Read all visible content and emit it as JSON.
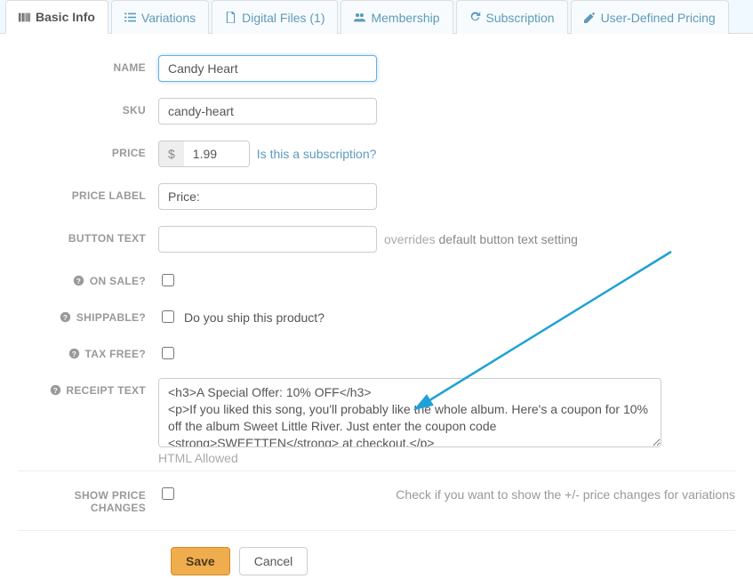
{
  "tabs": {
    "basic_info": "Basic Info",
    "variations": "Variations",
    "digital_files": "Digital Files (1)",
    "membership": "Membership",
    "subscription": "Subscription",
    "user_defined_pricing": "User-Defined Pricing"
  },
  "labels": {
    "name": "NAME",
    "sku": "SKU",
    "price": "PRICE",
    "price_label": "PRICE LABEL",
    "button_text": "BUTTON TEXT",
    "on_sale": "ON SALE?",
    "shippable": "SHIPPABLE?",
    "tax_free": "TAX FREE?",
    "receipt_text": "RECEIPT TEXT",
    "show_price_changes": "SHOW PRICE CHANGES"
  },
  "fields": {
    "name": "Candy Heart",
    "sku": "candy-heart",
    "currency_symbol": "$",
    "price": "1.99",
    "price_label": "Price:",
    "button_text": "",
    "on_sale": false,
    "shippable": false,
    "shippable_hint": "Do you ship this product?",
    "tax_free": false,
    "receipt_text": "<h3>A Special Offer: 10% OFF</h3>\n<p>If you liked this song, you'll probably like the whole album. Here's a coupon for 10% off the album Sweet Little River. Just enter the coupon code <strong>SWEETTEN</strong> at checkout.</p>",
    "receipt_hint": "HTML Allowed",
    "show_price_changes": false,
    "show_price_changes_hint": "Check if you want to show the +/- price changes for variations"
  },
  "hints": {
    "is_subscription": "Is this a subscription?",
    "button_text_override1": "overrides",
    "button_text_override2": "default button text setting"
  },
  "buttons": {
    "save": "Save",
    "cancel": "Cancel"
  }
}
